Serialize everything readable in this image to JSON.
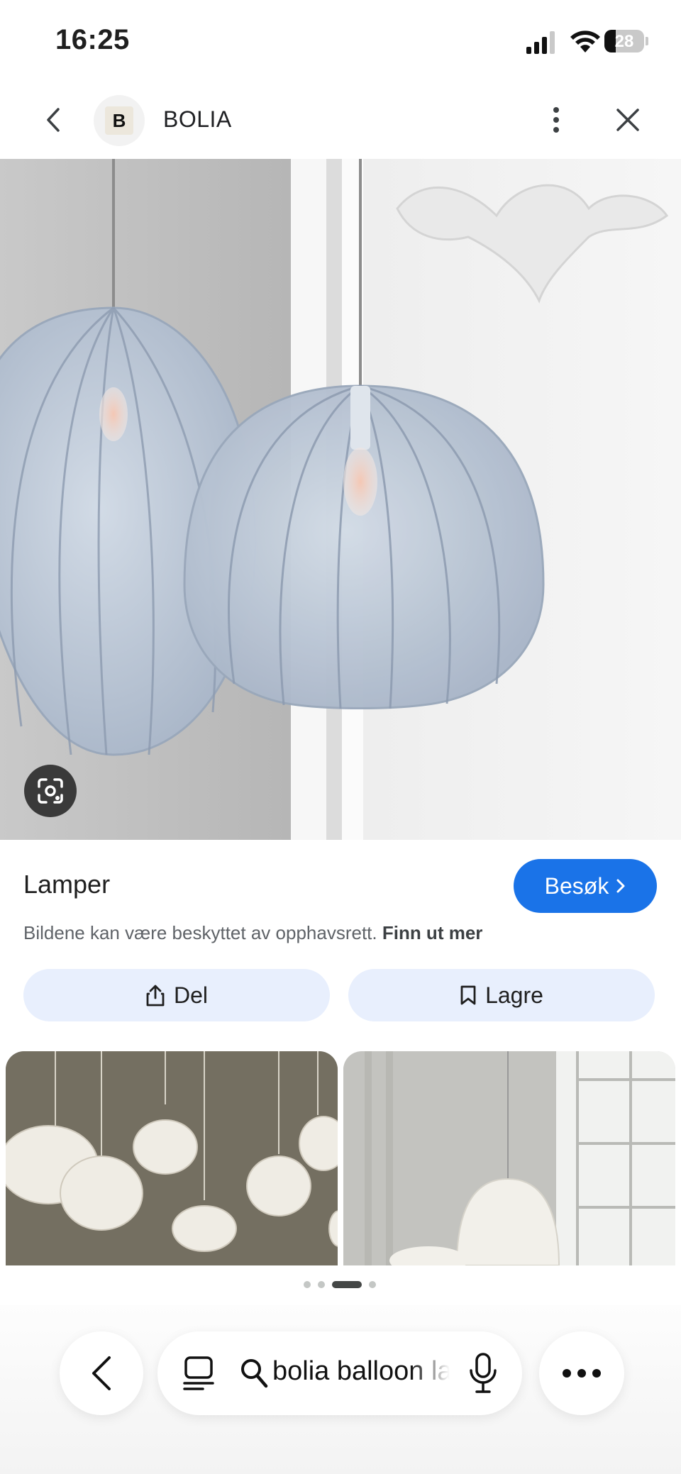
{
  "status_bar": {
    "time": "16:25",
    "battery_level": "28",
    "battery_fraction": 0.28
  },
  "header": {
    "site_name": "BOLIA",
    "logo_letter": "B"
  },
  "result": {
    "title": "Lamper",
    "visit_label": "Besøk",
    "copyright_text": "Bildene kan være beskyttet av opphavsrett.",
    "learn_more": "Finn ut mer"
  },
  "actions": {
    "share_label": "Del",
    "save_label": "Lagre"
  },
  "pager": {
    "count": 4,
    "active_index": 2
  },
  "bottom_bar": {
    "search_query": "bolia balloon lamp"
  },
  "icons": [
    "back-arrow-icon",
    "more-vert-icon",
    "close-icon",
    "lens-icon",
    "chevron-right-icon",
    "share-icon",
    "bookmark-icon",
    "tabs-icon",
    "search-icon",
    "mic-icon",
    "more-horiz-icon"
  ],
  "colors": {
    "accent": "#1a73e8",
    "pill_bg": "#e8effd",
    "lamp_shade": "#b8c4d4"
  }
}
